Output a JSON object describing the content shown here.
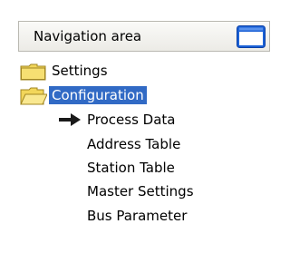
{
  "header": {
    "title": "Navigation area",
    "toggle_icon": "window-panel-icon",
    "accent": "#1c62d6"
  },
  "tree": {
    "items": [
      {
        "label": "Settings",
        "icon": "folder-closed-icon",
        "selected": false
      },
      {
        "label": "Configuration",
        "icon": "folder-open-icon",
        "selected": true
      },
      {
        "label": "Process Data",
        "icon": "arrow-right-icon",
        "current": true
      },
      {
        "label": "Address Table"
      },
      {
        "label": "Station Table"
      },
      {
        "label": "Master Settings"
      },
      {
        "label": "Bus Parameter"
      }
    ],
    "selection_color": "#316ac5"
  }
}
